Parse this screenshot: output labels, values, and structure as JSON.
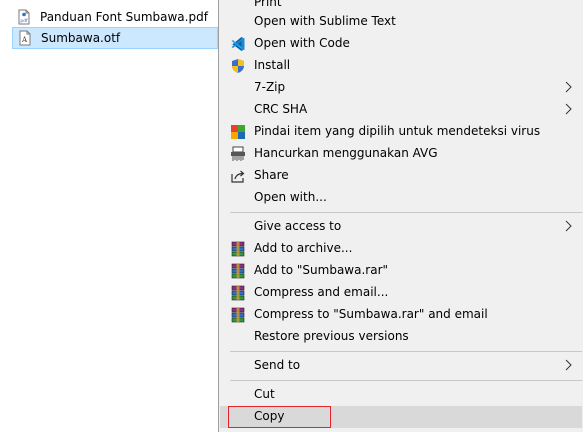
{
  "files": [
    {
      "name": "Panduan Font Sumbawa.pdf",
      "icon": "pdf-file-icon"
    },
    {
      "name": "Sumbawa.otf",
      "icon": "font-file-icon",
      "selected": true
    }
  ],
  "menu": {
    "items": [
      {
        "label": "Print"
      },
      {
        "label": "Open with Sublime Text"
      },
      {
        "label": "Open with Code",
        "icon": "vscode-icon"
      },
      {
        "label": "Install",
        "icon": "shield-icon"
      },
      {
        "label": "7-Zip",
        "submenu": true
      },
      {
        "label": "CRC SHA",
        "submenu": true
      },
      {
        "label": "Pindai item yang dipilih untuk mendeteksi virus",
        "icon": "avg-scan-icon"
      },
      {
        "label": "Hancurkan menggunakan AVG",
        "icon": "shredder-icon"
      },
      {
        "label": "Share",
        "icon": "share-icon"
      },
      {
        "label": "Open with..."
      },
      {
        "label": "Give access to",
        "submenu": true
      },
      {
        "label": "Add to archive...",
        "icon": "winrar-icon"
      },
      {
        "label": "Add to \"Sumbawa.rar\"",
        "icon": "winrar-icon"
      },
      {
        "label": "Compress and email...",
        "icon": "winrar-icon"
      },
      {
        "label": "Compress to \"Sumbawa.rar\" and email",
        "icon": "winrar-icon"
      },
      {
        "label": "Restore previous versions"
      },
      {
        "label": "Send to",
        "submenu": true
      },
      {
        "label": "Cut"
      },
      {
        "label": "Copy",
        "highlighted": true
      }
    ]
  },
  "colors": {
    "selection_bg": "#cce8ff",
    "menu_bg": "#f0f0f0",
    "highlight_border": "#e0252b"
  }
}
